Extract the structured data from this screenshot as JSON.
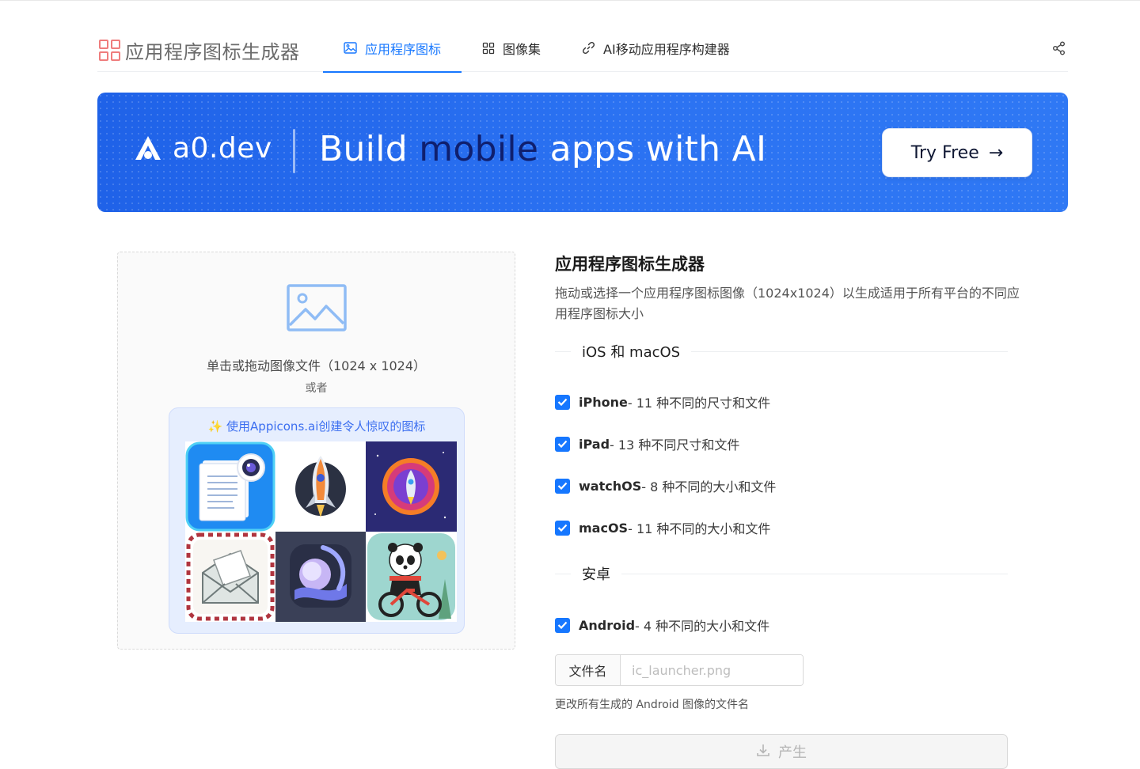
{
  "header": {
    "logo_title": "应用程序图标生成器",
    "tabs": [
      {
        "label": "应用程序图标",
        "icon": "image-icon",
        "active": true
      },
      {
        "label": "图像集",
        "icon": "grid-icon",
        "active": false
      },
      {
        "label": "AI移动应用程序构建器",
        "icon": "link-icon",
        "active": false
      }
    ],
    "share_icon": "share-icon"
  },
  "banner": {
    "brand_name": "a0.dev",
    "headline_pre": "Build ",
    "headline_highlight": "mobile",
    "headline_post": " apps with AI",
    "cta_label": "Try Free",
    "cta_arrow": "→",
    "colors": {
      "background": "#2a6ff0",
      "highlight": "#0f1f6e"
    }
  },
  "upload": {
    "prompt": "单击或拖动图像文件（1024 x 1024）",
    "or_text": "或者",
    "promo_text": "✨ 使用Appicons.ai创建令人惊叹的图标"
  },
  "panel": {
    "title": "应用程序图标生成器",
    "description": "拖动或选择一个应用程序图标图像（1024x1024）以生成适用于所有平台的不同应用程序图标大小",
    "section_ios": "iOS 和 macOS",
    "section_android": "安卓",
    "options": [
      {
        "name": "iPhone",
        "detail": " - 11 种不同的尺寸和文件",
        "checked": true
      },
      {
        "name": "iPad",
        "detail": " - 13 种不同尺寸和文件",
        "checked": true
      },
      {
        "name": "watchOS",
        "detail": " - 8 种不同的大小和文件",
        "checked": true
      },
      {
        "name": "macOS",
        "detail": " - 11 种不同的大小和文件",
        "checked": true
      },
      {
        "name": "Android",
        "detail": " - 4 种不同的大小和文件",
        "checked": true
      }
    ],
    "filename_label": "文件名",
    "filename_placeholder": "ic_launcher.png",
    "filename_hint": "更改所有生成的 Android 图像的文件名",
    "generate_label": "产生"
  },
  "accent_color": "#1677ff"
}
